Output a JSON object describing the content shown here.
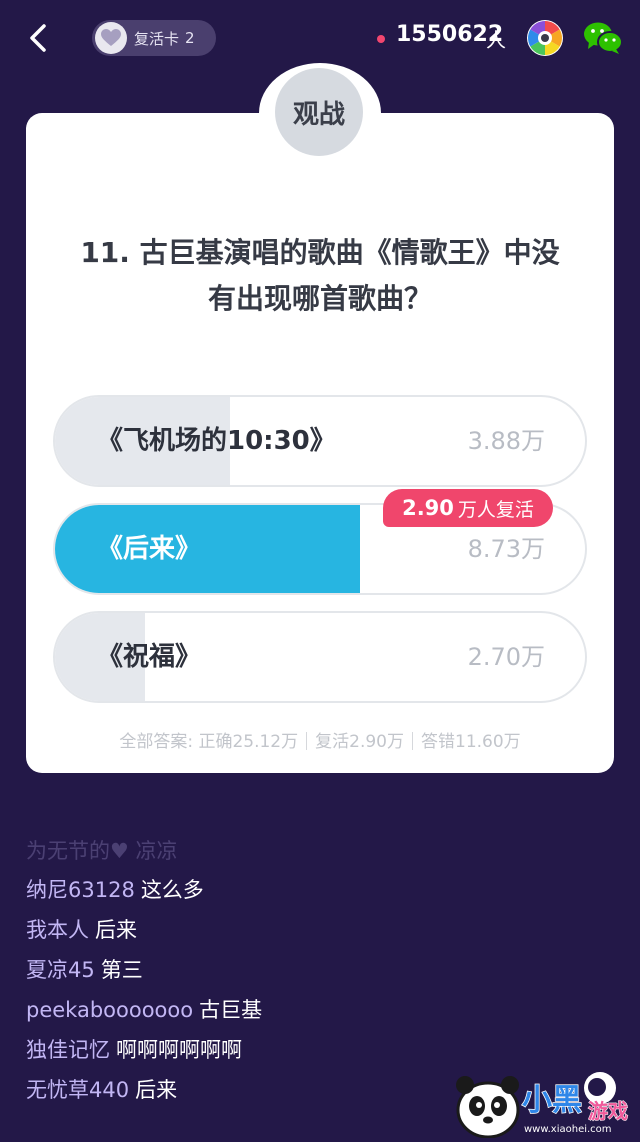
{
  "header": {
    "revive_card_label": "复活卡",
    "revive_card_count": "2",
    "viewer_count": "1550622",
    "viewer_unit": "人"
  },
  "card": {
    "spectate_label": "观战",
    "question_line1": "11. 古巨基演唱的歌曲《情歌王》中没",
    "question_line2": "有出现哪首歌曲？",
    "options": [
      {
        "label": "《飞机场的10:30》",
        "count": "3.88万",
        "ratio": 0.33
      },
      {
        "label": "《后来》",
        "count": "8.73万",
        "ratio": 0.575,
        "selected": true
      },
      {
        "label": "《祝福》",
        "count": "2.70万",
        "ratio": 0.17
      }
    ],
    "revive_badge_number": "2.90",
    "revive_badge_text": "万人复活",
    "summary": {
      "prefix": "全部答案: 正确25.12万",
      "revived": "复活2.90万",
      "wrong": "答错11.60万"
    }
  },
  "comments": {
    "faded": "为无节的♥ 凉凉",
    "items": [
      {
        "user": "纳尼63128",
        "text": "这么多"
      },
      {
        "user": "我本人",
        "text": "后来"
      },
      {
        "user": "夏凉45",
        "text": "第三"
      },
      {
        "user": "peekabooooooo",
        "text": "古巨基"
      },
      {
        "user": "独佳记忆",
        "text": "啊啊啊啊啊啊"
      },
      {
        "user": "无忧草440",
        "text": "后来"
      }
    ]
  },
  "watermark": {
    "brand": "小黑游戏",
    "url": "www.xiaohei.com"
  },
  "colors": {
    "background": "#231848",
    "selected_fill": "#27b5e1",
    "badge": "#f0466c",
    "username": "#c2b6f4"
  },
  "icons": {
    "back": "chevron-left-icon",
    "heart": "heart-icon",
    "live_dot": "live-dot-icon",
    "camera": "camera-aperture-icon",
    "wechat": "wechat-icon"
  }
}
